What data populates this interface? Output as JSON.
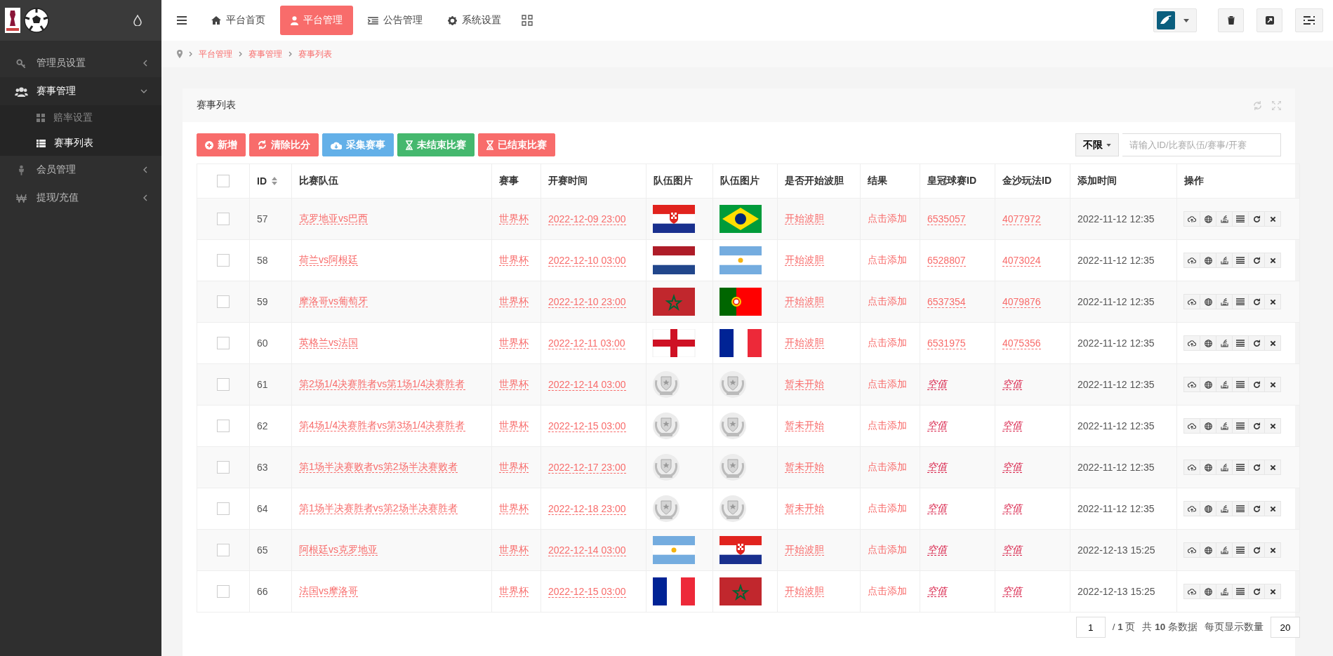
{
  "sidebar": {
    "items": [
      {
        "label": "管理员设置",
        "expanded": false
      },
      {
        "label": "赛事管理",
        "expanded": true,
        "children": [
          {
            "label": "赔率设置",
            "selected": false
          },
          {
            "label": "赛事列表",
            "selected": true
          }
        ]
      },
      {
        "label": "会员管理",
        "expanded": false
      },
      {
        "label": "提现/充值",
        "expanded": false
      }
    ]
  },
  "topnav": {
    "tabs": [
      {
        "label": "平台首页",
        "selected": false
      },
      {
        "label": "平台管理",
        "selected": true
      },
      {
        "label": "公告管理",
        "selected": false
      },
      {
        "label": "系统设置",
        "selected": false
      }
    ]
  },
  "breadcrumb": [
    "平台管理",
    "赛事管理",
    "赛事列表"
  ],
  "panel": {
    "title": "赛事列表",
    "toolbar": [
      {
        "label": "新增",
        "color": "#f86c6b"
      },
      {
        "label": "清除比分",
        "color": "#f86c6b"
      },
      {
        "label": "采集赛事",
        "color": "#63b0e8"
      },
      {
        "label": "未结束比赛",
        "color": "#45b86e"
      },
      {
        "label": "已结束比赛",
        "color": "#f86c6b"
      }
    ],
    "filter": {
      "value": "不限",
      "placeholder": "请输入ID/比赛队伍/赛事/开赛"
    },
    "table": {
      "select_all_checked": false,
      "columns": [
        "ID",
        "比赛队伍",
        "赛事",
        "开赛时间",
        "队伍图片",
        "队伍图片",
        "是否开始波胆",
        "结果",
        "皇冠球赛ID",
        "金沙玩法ID",
        "添加时间",
        "操作"
      ],
      "rows": [
        {
          "checked": false,
          "id": "57",
          "teams": "克罗地亚vs巴西",
          "event": "世界杯",
          "start": "2022-12-09 23:00",
          "images": [
            {
              "kind": "croatia"
            },
            {
              "kind": "brazil"
            }
          ],
          "status": "开始波胆",
          "result": "点击添加",
          "crown_id": "6535057",
          "jinsha_id": "4077972",
          "crown_empty": false,
          "jinsha_empty": false,
          "added": "2022-11-12 12:35"
        },
        {
          "checked": false,
          "id": "58",
          "teams": "荷兰vs阿根廷",
          "event": "世界杯",
          "start": "2022-12-10 03:00",
          "images": [
            {
              "kind": "netherlands"
            },
            {
              "kind": "argentina"
            }
          ],
          "status": "开始波胆",
          "result": "点击添加",
          "crown_id": "6528807",
          "jinsha_id": "4073024",
          "crown_empty": false,
          "jinsha_empty": false,
          "added": "2022-11-12 12:35"
        },
        {
          "checked": false,
          "id": "59",
          "teams": "摩洛哥vs葡萄牙",
          "event": "世界杯",
          "start": "2022-12-10 23:00",
          "images": [
            {
              "kind": "morocco"
            },
            {
              "kind": "portugal"
            }
          ],
          "status": "开始波胆",
          "result": "点击添加",
          "crown_id": "6537354",
          "jinsha_id": "4079876",
          "crown_empty": false,
          "jinsha_empty": false,
          "added": "2022-11-12 12:35"
        },
        {
          "checked": false,
          "id": "60",
          "teams": "英格兰vs法国",
          "event": "世界杯",
          "start": "2022-12-11 03:00",
          "images": [
            {
              "kind": "england"
            },
            {
              "kind": "france"
            }
          ],
          "status": "开始波胆",
          "result": "点击添加",
          "crown_id": "6531975",
          "jinsha_id": "4075356",
          "crown_empty": false,
          "jinsha_empty": false,
          "added": "2022-11-12 12:35"
        },
        {
          "checked": false,
          "id": "61",
          "teams": "第2场1/4决赛胜者vs第1场1/4决赛胜者",
          "event": "世界杯",
          "start": "2022-12-14 03:00",
          "images": [
            {
              "kind": "team"
            },
            {
              "kind": "team"
            }
          ],
          "status": "暂未开始",
          "result": "点击添加",
          "crown_id": "空值",
          "jinsha_id": "空值",
          "crown_empty": true,
          "jinsha_empty": true,
          "added": "2022-11-12 12:35"
        },
        {
          "checked": false,
          "id": "62",
          "teams": "第4场1/4决赛胜者vs第3场1/4决赛胜者",
          "event": "世界杯",
          "start": "2022-12-15 03:00",
          "images": [
            {
              "kind": "team"
            },
            {
              "kind": "team"
            }
          ],
          "status": "暂未开始",
          "result": "点击添加",
          "crown_id": "空值",
          "jinsha_id": "空值",
          "crown_empty": true,
          "jinsha_empty": true,
          "added": "2022-11-12 12:35"
        },
        {
          "checked": false,
          "id": "63",
          "teams": "第1场半决赛败者vs第2场半决赛败者",
          "event": "世界杯",
          "start": "2022-12-17 23:00",
          "images": [
            {
              "kind": "team"
            },
            {
              "kind": "team"
            }
          ],
          "status": "暂未开始",
          "result": "点击添加",
          "crown_id": "空值",
          "jinsha_id": "空值",
          "crown_empty": true,
          "jinsha_empty": true,
          "added": "2022-11-12 12:35"
        },
        {
          "checked": false,
          "id": "64",
          "teams": "第1场半决赛胜者vs第2场半决赛胜者",
          "event": "世界杯",
          "start": "2022-12-18 23:00",
          "images": [
            {
              "kind": "team"
            },
            {
              "kind": "team"
            }
          ],
          "status": "暂未开始",
          "result": "点击添加",
          "crown_id": "空值",
          "jinsha_id": "空值",
          "crown_empty": true,
          "jinsha_empty": true,
          "added": "2022-11-12 12:35"
        },
        {
          "checked": false,
          "id": "65",
          "teams": "阿根廷vs克罗地亚",
          "event": "世界杯",
          "start": "2022-12-14 03:00",
          "images": [
            {
              "kind": "argentina"
            },
            {
              "kind": "croatia"
            }
          ],
          "status": "开始波胆",
          "result": "点击添加",
          "crown_id": "空值",
          "jinsha_id": "空值",
          "crown_empty": true,
          "jinsha_empty": true,
          "added": "2022-12-13 15:25"
        },
        {
          "checked": false,
          "id": "66",
          "teams": "法国vs摩洛哥",
          "event": "世界杯",
          "start": "2022-12-15 03:00",
          "images": [
            {
              "kind": "france"
            },
            {
              "kind": "morocco"
            }
          ],
          "status": "开始波胆",
          "result": "点击添加",
          "crown_id": "空值",
          "jinsha_id": "空值",
          "crown_empty": true,
          "jinsha_empty": true,
          "added": "2022-12-13 15:25"
        }
      ]
    },
    "pagination": {
      "page": "1",
      "pages": "/ **1** 页",
      "total": "共 **10** 条数据",
      "per_page_label": "每页显示数量",
      "per_page": "20"
    }
  }
}
